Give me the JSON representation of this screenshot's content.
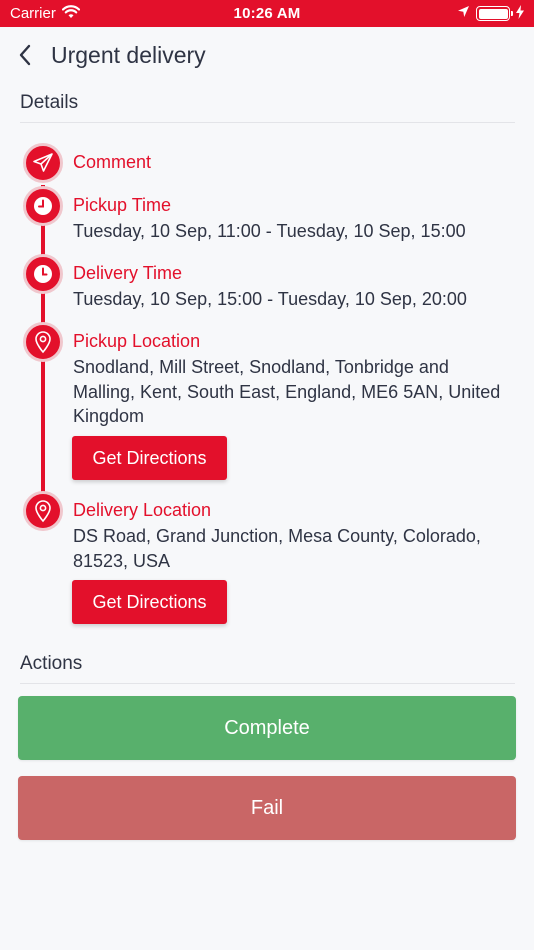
{
  "status_bar": {
    "carrier": "Carrier",
    "time": "10:26 AM",
    "battery_level": 1.0
  },
  "nav": {
    "title": "Urgent delivery",
    "back_icon": "chevron-left-icon"
  },
  "details": {
    "section_title": "Details",
    "items": [
      {
        "icon": "paper-plane-icon",
        "label": "Comment",
        "text": ""
      },
      {
        "icon": "clock-icon",
        "label": "Pickup Time",
        "text": "Tuesday, 10 Sep, 11:00 - Tuesday, 10 Sep, 15:00"
      },
      {
        "icon": "clock-icon",
        "label": "Delivery Time",
        "text": "Tuesday, 10 Sep, 15:00 - Tuesday, 10 Sep, 20:00"
      },
      {
        "icon": "location-pin-icon",
        "label": "Pickup Location",
        "text": "Snodland, Mill Street, Snodland, Tonbridge and Malling, Kent, South East, England, ME6 5AN, United Kingdom",
        "button": "Get Directions"
      },
      {
        "icon": "location-pin-icon",
        "label": "Delivery Location",
        "text": "DS Road, Grand Junction, Mesa County, Colorado, 81523, USA",
        "button": "Get Directions"
      }
    ]
  },
  "actions": {
    "section_title": "Actions",
    "complete_label": "Complete",
    "fail_label": "Fail"
  },
  "colors": {
    "brand_red": "#e3102b",
    "complete_green": "#58b06c",
    "fail_red": "#c96666",
    "text_dark": "#2f3444",
    "background": "#f7f8fa"
  }
}
